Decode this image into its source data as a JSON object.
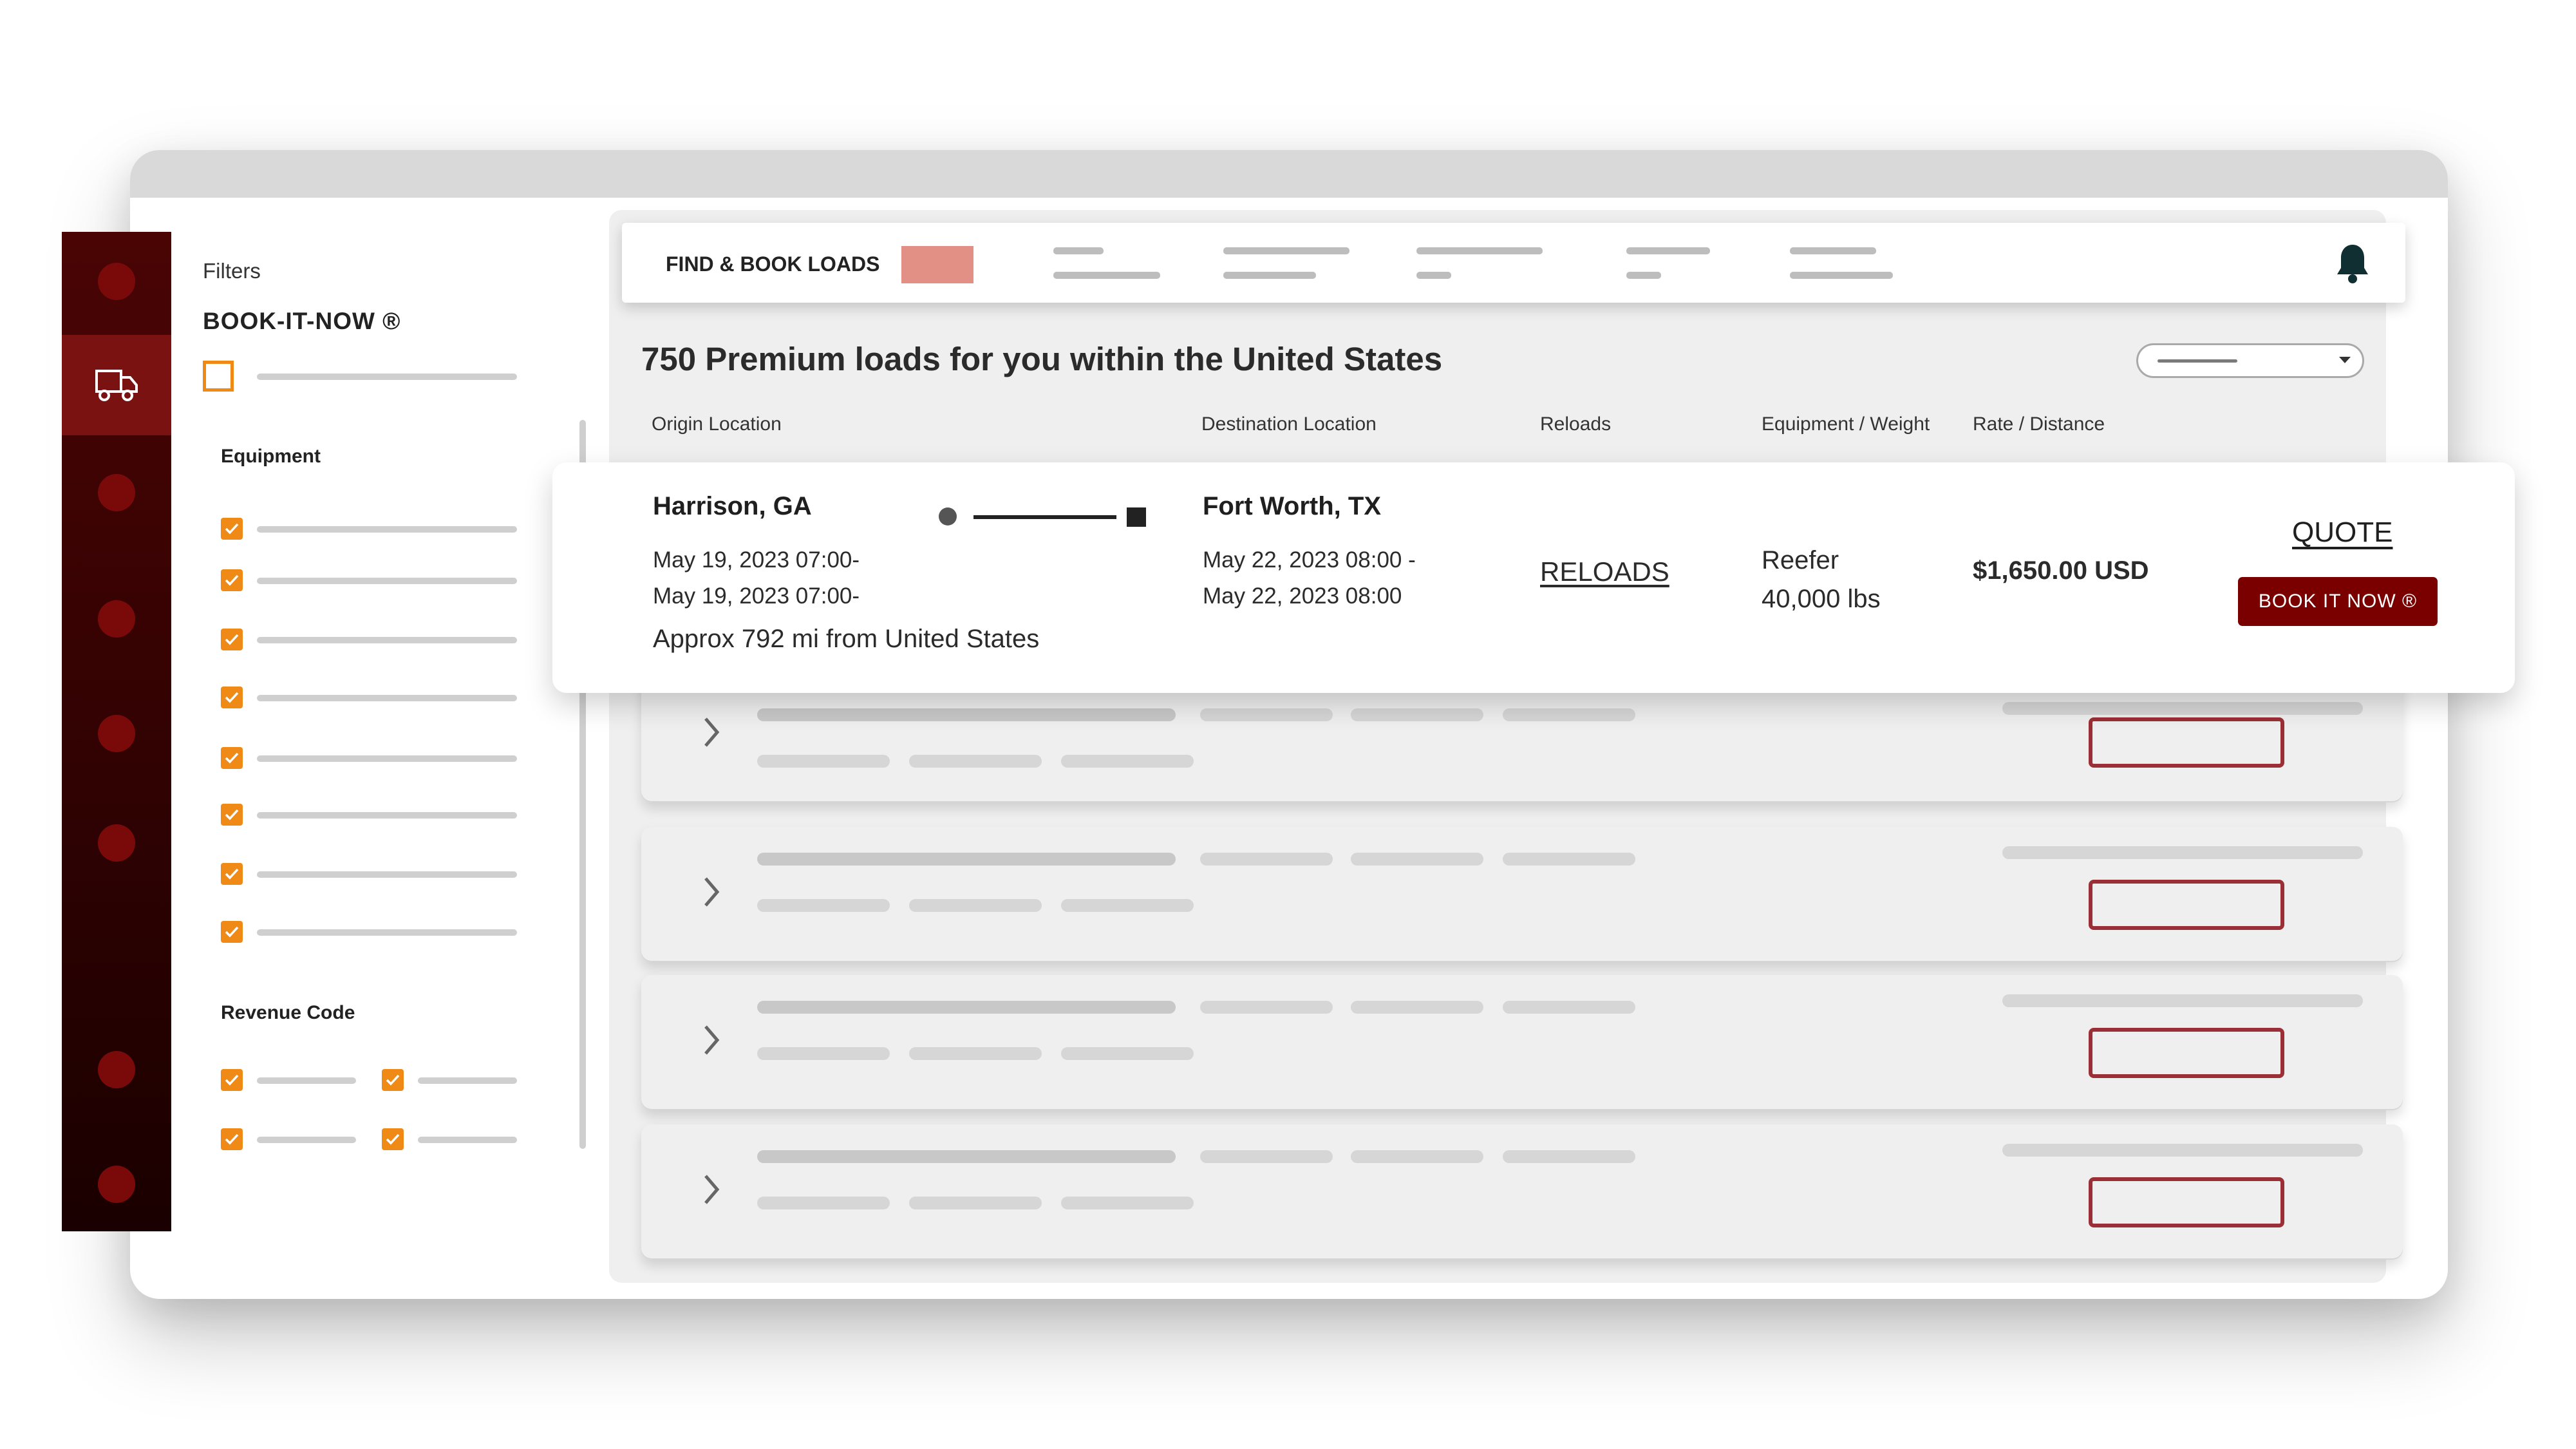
{
  "nav": {
    "items": [
      {
        "icon": "circle-icon"
      },
      {
        "icon": "truck-icon",
        "active": true
      },
      {
        "icon": "circle-icon"
      },
      {
        "icon": "circle-icon"
      },
      {
        "icon": "circle-icon"
      },
      {
        "icon": "circle-icon"
      },
      {
        "icon": "circle-icon"
      },
      {
        "icon": "circle-icon"
      }
    ]
  },
  "filters": {
    "title": "Filters",
    "book_it_now": "BOOK-IT-NOW ®",
    "equipment_label": "Equipment",
    "revenue_code_label": "Revenue Code"
  },
  "topnav": {
    "title": "FIND & BOOK LOADS"
  },
  "main": {
    "heading": "750 Premium loads for you within the United States",
    "columns": {
      "origin": "Origin Location",
      "destination": "Destination Location",
      "reloads": "Reloads",
      "equipment": "Equipment / Weight",
      "rate": "Rate / Distance"
    }
  },
  "load": {
    "origin_city": "Harrison, GA",
    "origin_date_1": "May 19, 2023 07:00-",
    "origin_date_2": "May 19, 2023 07:00-",
    "distance": "Approx 792 mi from United States",
    "dest_city": "Fort Worth, TX",
    "dest_date_1": "May 22, 2023 08:00 -",
    "dest_date_2": "May 22, 2023 08:00",
    "reloads_link": "RELOADS",
    "equipment": "Reefer",
    "weight": "40,000 lbs",
    "rate": "$1,650.00 USD",
    "quote_label": "QUOTE",
    "book_label": "BOOK IT NOW ®"
  },
  "colors": {
    "brand_dark": "#7a0000",
    "nav_bg": "#330202",
    "checkbox": "#f08a16",
    "swatch": "#e28f86"
  }
}
